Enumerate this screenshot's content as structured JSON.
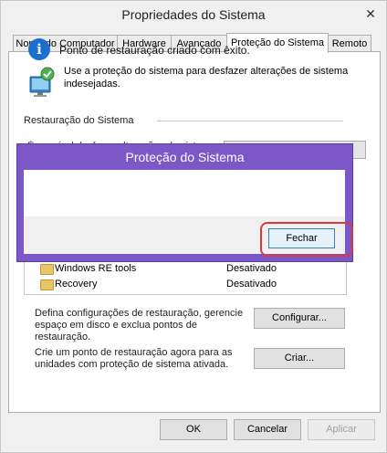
{
  "window": {
    "title": "Propriedades do Sistema",
    "close_glyph": "✕"
  },
  "tabs": [
    {
      "label": "Nome do Computador",
      "active": false
    },
    {
      "label": "Hardware",
      "active": false
    },
    {
      "label": "Avançado",
      "active": false
    },
    {
      "label": "Proteção do Sistema",
      "active": true
    },
    {
      "label": "Remoto",
      "active": false
    }
  ],
  "panel": {
    "intro": "Use a proteção do sistema para desfazer alterações de sistema indesejadas.",
    "section_label": "Restauração do Sistema",
    "obscured_text": "É possível desfazer alterações do sistema",
    "drives": [
      {
        "name": "Windows RE tools",
        "status": "Desativado"
      },
      {
        "name": "Recovery",
        "status": "Desativado"
      }
    ],
    "configure_desc": "Defina configurações de restauração, gerencie espaço em disco e exclua pontos de restauração.",
    "configure_button": "Configurar...",
    "create_desc": "Crie um ponto de restauração agora para as unidades com proteção de sistema ativada.",
    "create_button": "Criar..."
  },
  "footer": {
    "ok": "OK",
    "cancel": "Cancelar",
    "apply": "Aplicar"
  },
  "dialog": {
    "title": "Proteção do Sistema",
    "message": "Ponto de restauração criado com êxito.",
    "close_button": "Fechar",
    "info_glyph": "i"
  },
  "colors": {
    "dialog_frame": "#7b57c8",
    "highlight": "#d93a3a",
    "info_blue": "#1c6fcf"
  }
}
